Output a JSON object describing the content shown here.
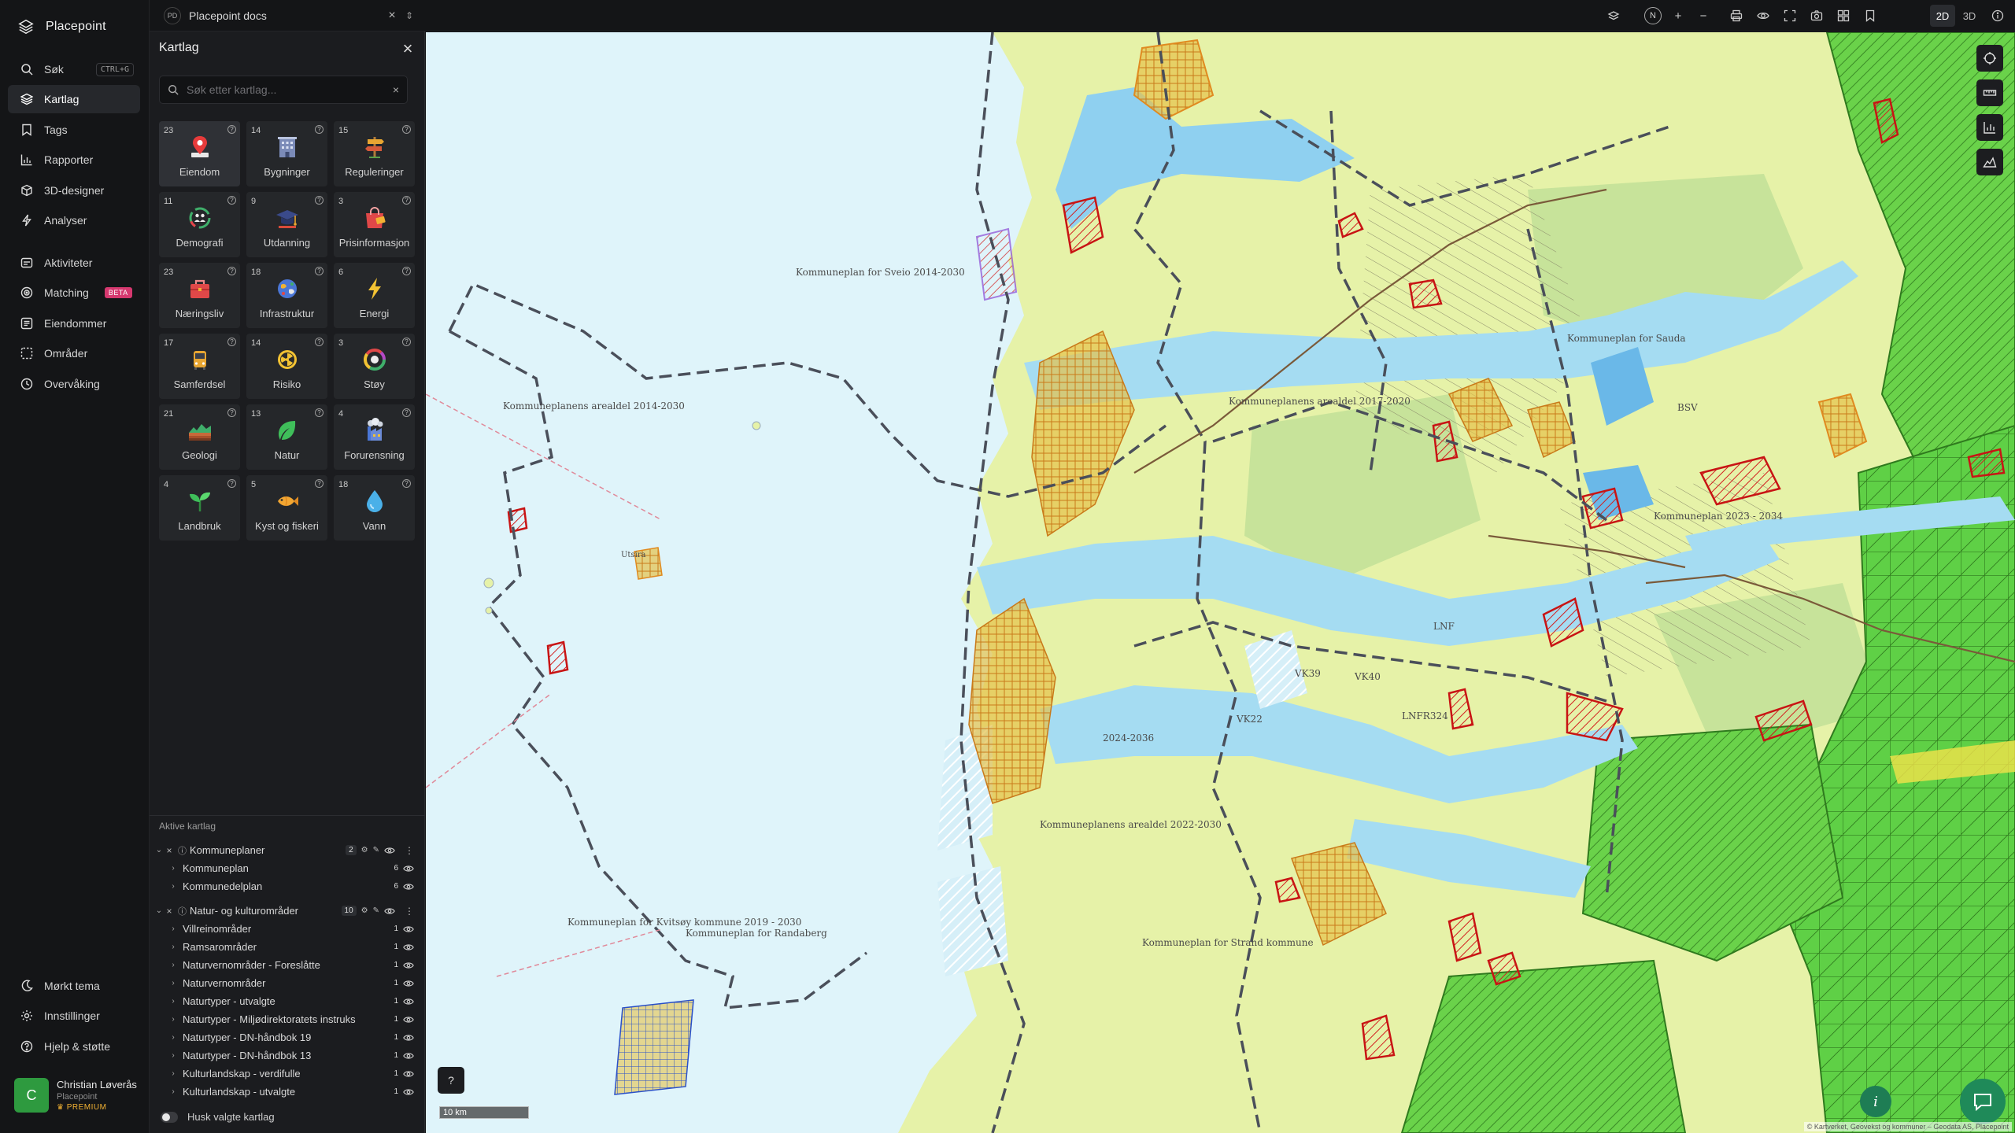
{
  "app": {
    "name": "Placepoint"
  },
  "nav": {
    "items": [
      {
        "label": "Søk",
        "shortcut": "CTRL+G"
      },
      {
        "label": "Kartlag"
      },
      {
        "label": "Tags"
      },
      {
        "label": "Rapporter"
      },
      {
        "label": "3D-designer"
      },
      {
        "label": "Analyser"
      },
      {
        "label": "Aktiviteter"
      },
      {
        "label": "Matching",
        "badge": "BETA"
      },
      {
        "label": "Eiendommer"
      },
      {
        "label": "Områder"
      },
      {
        "label": "Overvåking"
      }
    ],
    "bottom": [
      {
        "label": "Mørkt tema"
      },
      {
        "label": "Innstillinger"
      },
      {
        "label": "Hjelp & støtte"
      }
    ],
    "user": {
      "initial": "C",
      "name": "Christian Løverås",
      "org": "Placepoint",
      "tier": "PREMIUM"
    }
  },
  "topbar": {
    "doc_badge": "PD",
    "doc_title": "Placepoint docs",
    "compass": "N",
    "mode_2d": "2D",
    "mode_3d": "3D"
  },
  "panel": {
    "title": "Kartlag",
    "search_placeholder": "Søk etter kartlag...",
    "categories": [
      {
        "count": "23",
        "label": "Eiendom"
      },
      {
        "count": "14",
        "label": "Bygninger"
      },
      {
        "count": "15",
        "label": "Reguleringer"
      },
      {
        "count": "11",
        "label": "Demografi"
      },
      {
        "count": "9",
        "label": "Utdanning"
      },
      {
        "count": "3",
        "label": "Prisinformasjon"
      },
      {
        "count": "23",
        "label": "Næringsliv"
      },
      {
        "count": "18",
        "label": "Infrastruktur"
      },
      {
        "count": "6",
        "label": "Energi"
      },
      {
        "count": "17",
        "label": "Samferdsel"
      },
      {
        "count": "14",
        "label": "Risiko"
      },
      {
        "count": "3",
        "label": "Støy"
      },
      {
        "count": "21",
        "label": "Geologi"
      },
      {
        "count": "13",
        "label": "Natur"
      },
      {
        "count": "4",
        "label": "Forurensning"
      },
      {
        "count": "4",
        "label": "Landbruk"
      },
      {
        "count": "5",
        "label": "Kyst og fiskeri"
      },
      {
        "count": "18",
        "label": "Vann"
      }
    ],
    "active_title": "Aktive kartlag",
    "groups": [
      {
        "name": "Kommuneplaner",
        "count": "2",
        "layers": [
          {
            "name": "Kommuneplan",
            "count": "6"
          },
          {
            "name": "Kommunedelplan",
            "count": "6"
          }
        ]
      },
      {
        "name": "Natur- og kulturområder",
        "count": "10",
        "layers": [
          {
            "name": "Villreinområder",
            "count": "1"
          },
          {
            "name": "Ramsarområder",
            "count": "1"
          },
          {
            "name": "Naturvernområder - Foreslåtte",
            "count": "1"
          },
          {
            "name": "Naturvernområder",
            "count": "1"
          },
          {
            "name": "Naturtyper - utvalgte",
            "count": "1"
          },
          {
            "name": "Naturtyper - Miljødirektoratets instruks",
            "count": "1"
          },
          {
            "name": "Naturtyper - DN-håndbok 19",
            "count": "1"
          },
          {
            "name": "Naturtyper - DN-håndbok 13",
            "count": "1"
          },
          {
            "name": "Kulturlandskap - verdifulle",
            "count": "1"
          },
          {
            "name": "Kulturlandskap - utvalgte",
            "count": "1"
          }
        ]
      }
    ],
    "remember_label": "Husk valgte kartlag"
  },
  "map": {
    "scale": "10 km",
    "attribution": "© Kartverket, Geovekst og kommuner – Geodata AS, Placepoint",
    "labels": [
      "Kommuneplanens arealdel 2014-2030",
      "Kommuneplan for Sveio 2014-2030",
      "Kommuneplanens arealdel 2017-2020",
      "Kommuneplan 2023 - 2034",
      "Kommuneplan for Sauda",
      "Kommuneplan for Kvitsøy kommune 2019 - 2030",
      "Kommuneplan for Randaberg",
      "Kommuneplan for Strand kommune",
      "Kommuneplanens arealdel 2022-2030",
      "Utsira",
      "LNF",
      "BSV",
      "VK39",
      "VK40",
      "VK22",
      "LNFR324",
      "2024-2036"
    ]
  }
}
